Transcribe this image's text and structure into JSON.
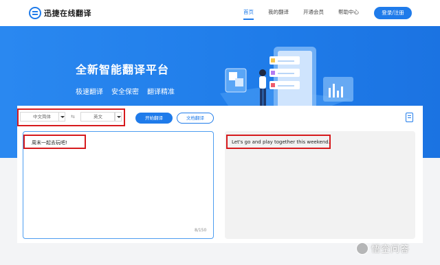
{
  "header": {
    "logo_text": "迅捷在线翻译",
    "nav": [
      {
        "label": "首页",
        "active": true
      },
      {
        "label": "我的翻译",
        "active": false
      },
      {
        "label": "开通会员",
        "active": false
      },
      {
        "label": "帮助中心",
        "active": false
      }
    ],
    "login_label": "登录/注册"
  },
  "banner": {
    "title": "全新智能翻译平台",
    "features": [
      "极速翻译",
      "安全保密",
      "翻译精准"
    ]
  },
  "translator": {
    "source_lang": "中文简体",
    "swap_symbol": "⇆",
    "target_lang": "英文",
    "translate_label": "开始翻译",
    "doc_translate_label": "文档翻译",
    "source_text": "周末一起去玩吧!",
    "target_text": "Let's go and play together this weekend.",
    "char_count": "8/150"
  },
  "watermark": {
    "text": "悟空问答"
  },
  "colors": {
    "accent": "#1f7bea",
    "highlight": "#d6191c",
    "banner": "#2a88f0"
  }
}
